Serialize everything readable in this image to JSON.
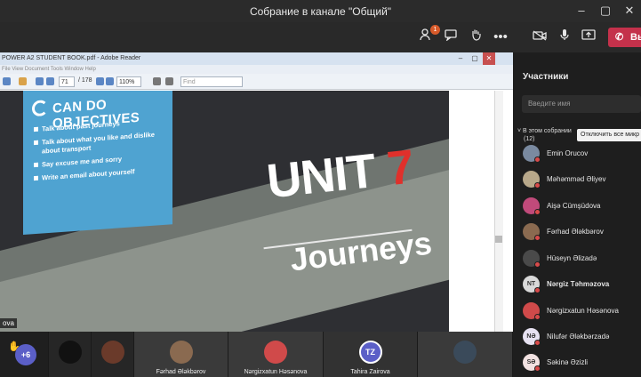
{
  "window": {
    "title": "Собрание в канале \"Общий\"",
    "min_icon": "minimize-icon",
    "max_icon": "maximize-icon",
    "close_icon": "close-icon"
  },
  "toolbar": {
    "participants_badge": "1",
    "leave_label": "Вы",
    "icons": [
      "people-icon",
      "chat-icon",
      "raise-hand-icon",
      "more-icon",
      "camera-off-icon",
      "mic-icon",
      "share-screen-icon",
      "phone-hangup-icon"
    ]
  },
  "reader": {
    "title": "POWER A2 STUDENT BOOK.pdf - Adobe Reader",
    "menu": "File  View  Document  Tools  Window  Help",
    "page_current": "71",
    "page_total": "/ 178",
    "zoom": "110%",
    "find_placeholder": "Find"
  },
  "book": {
    "objectives_title": "CAN DO OBJECTIVES",
    "objectives": [
      "Talk about past journeys",
      "Talk about what you like and dislike about transport",
      "Say excuse me and sorry",
      "Write an email about yourself"
    ],
    "unit_word": "UNIT",
    "unit_number": "7",
    "subtitle": "Journeys"
  },
  "presenter_label": "ova",
  "people_panel": {
    "title": "Участники",
    "search_placeholder": "Введите имя",
    "section_label": "В этом собрании",
    "section_count": "(12)",
    "mute_all_label": "Отключить все микр",
    "participants": [
      {
        "name": "Emin Orucov",
        "initials": "",
        "bold": false,
        "color": "#7a8aa0"
      },
      {
        "name": "Məhəmməd Əliyev",
        "initials": "",
        "bold": false,
        "color": "#b8a88a"
      },
      {
        "name": "Aişə Cümşüdova",
        "initials": "",
        "bold": false,
        "color": "#c04a7a"
      },
      {
        "name": "Fərhad Ələkbərov",
        "initials": "",
        "bold": false,
        "color": "#8a6a50"
      },
      {
        "name": "Hüseyn Əlizadə",
        "initials": "",
        "bold": false,
        "color": "#4a4a4a"
      },
      {
        "name": "Nərgiz Təhməzova",
        "initials": "NT",
        "bold": true,
        "color": "#d9d9d9"
      },
      {
        "name": "Nərgizxatun Həsənova",
        "initials": "",
        "bold": false,
        "color": "#d04a4a"
      },
      {
        "name": "Nilufər Ələkbərzadə",
        "initials": "NƏ",
        "bold": false,
        "color": "#e7e2f2"
      },
      {
        "name": "Səkinə Əzizli",
        "initials": "SƏ",
        "bold": false,
        "color": "#f2e2e2"
      }
    ]
  },
  "strip": {
    "more_count": "+6",
    "tiles": [
      {
        "name": "",
        "color": "#111"
      },
      {
        "name": "",
        "color": "#6a3a2a"
      },
      {
        "name": "Fərhad Ələkbərov",
        "color": "#8a6a50"
      },
      {
        "name": "Nərgizxatun Həsənova",
        "color": "#d04a4a"
      },
      {
        "name": "Tahira Zairova",
        "initials": "TZ",
        "color": "#5b5fc7"
      },
      {
        "name": "",
        "color": "#3a4a5a"
      }
    ]
  }
}
